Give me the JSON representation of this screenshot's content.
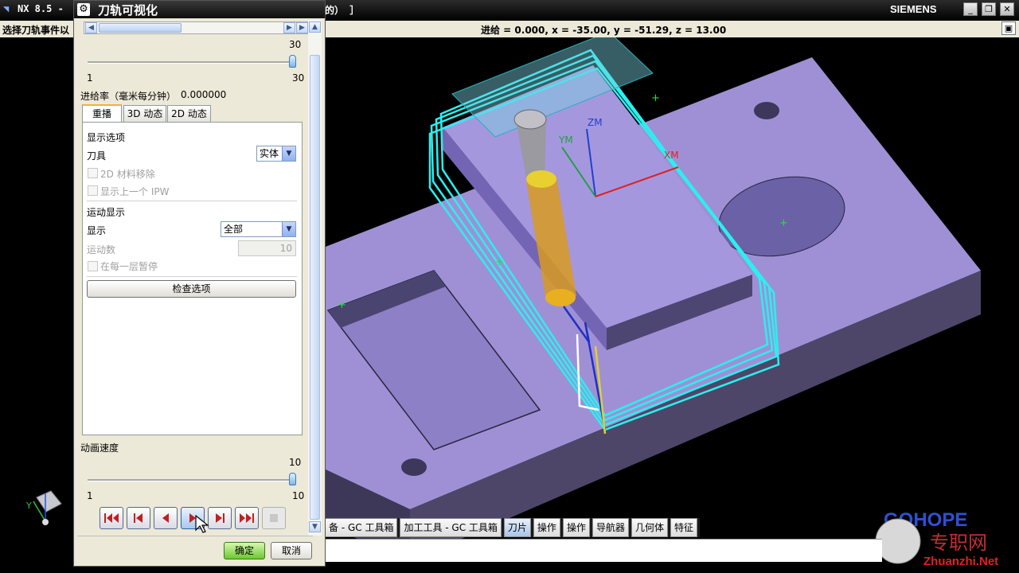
{
  "window": {
    "title": "NX 8.5 -",
    "title_suffix": "的） ］",
    "brand": "SIEMENS"
  },
  "status": {
    "prompt": "选择刀轨事件以",
    "readout": "进给 = 0.000, x = -35.00, y = -51.29, z = 13.00"
  },
  "dialog": {
    "title": "刀轨可视化",
    "slider1": {
      "max_label": "30",
      "min": "1",
      "max": "30",
      "value": 1.0
    },
    "feedrate_label": "进给率（毫米每分钟）",
    "feedrate_value": "0.000000",
    "tabs": [
      {
        "label": "重播",
        "active": true
      },
      {
        "label": "3D 动态",
        "active": false
      },
      {
        "label": "2D 动态",
        "active": false
      }
    ],
    "display_options_label": "显示选项",
    "tool_label": "刀具",
    "tool_value": "实体",
    "check_2d_removal": "2D 材料移除",
    "check_prev_ipw": "显示上一个 IPW",
    "motion_display_label": "运动显示",
    "show_label": "显示",
    "show_value": "全部",
    "motion_count_label": "运动数",
    "motion_count_value": "10",
    "pause_each_layer": "在每一层暂停",
    "check_options_button": "检查选项",
    "anim_speed_label": "动画速度",
    "slider2": {
      "max_label": "10",
      "min": "1",
      "max": "10",
      "value": 1.0
    },
    "ok_button": "确定",
    "cancel_button": "取消"
  },
  "resource_tabs": [
    {
      "label": "备 - GC 工具箱",
      "active": false
    },
    {
      "label": "加工工具 - GC 工具箱",
      "active": false
    },
    {
      "label": "刀片",
      "active": true
    },
    {
      "label": "操作",
      "active": false
    },
    {
      "label": "操作",
      "active": false
    },
    {
      "label": "导航器",
      "active": false
    },
    {
      "label": "几何体",
      "active": false
    },
    {
      "label": "特征",
      "active": false
    }
  ],
  "viewport": {
    "axis_zm": "ZM",
    "axis_ym": "YM",
    "axis_xm": "XM",
    "triad_y": "Y",
    "watermark_brand": "GOHOPE",
    "watermark_cn": "专职网",
    "watermark_url": "Zhuanzhi.Net"
  },
  "colors": {
    "part": "#9f90d6",
    "toolpath": "#2af0f0",
    "tool": "#e0a020",
    "dialog_bg": "#ece9d8"
  }
}
